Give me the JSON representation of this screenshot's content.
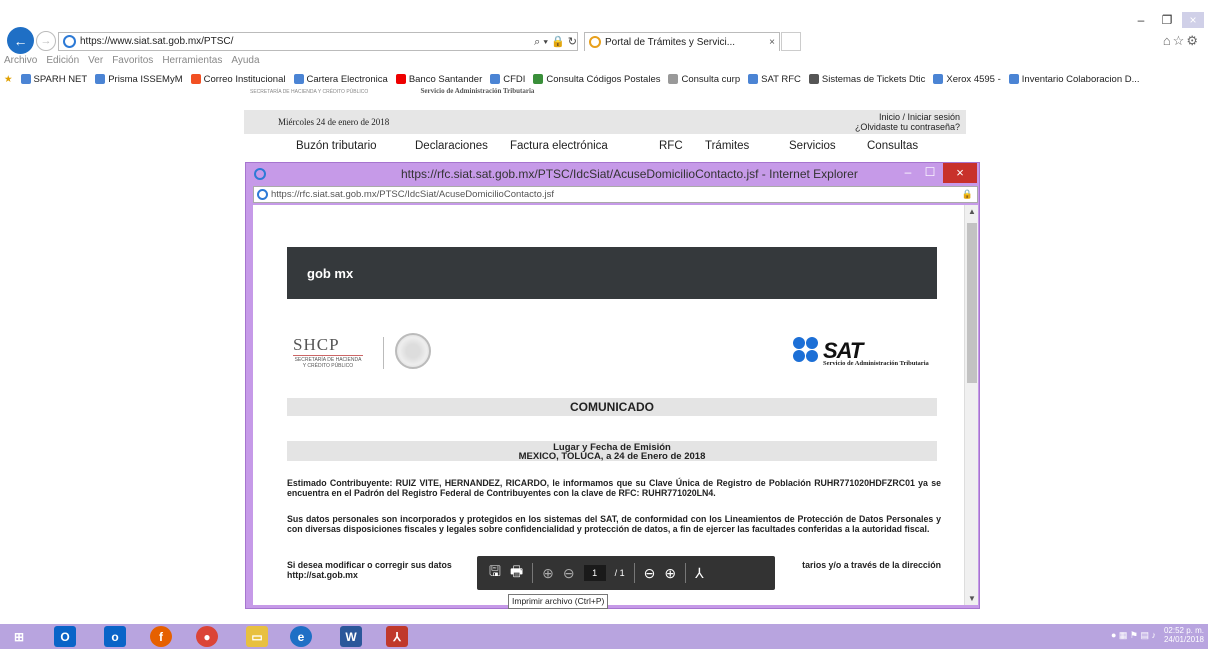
{
  "browser": {
    "url": "https://www.siat.sat.gob.mx/PTSC/",
    "tab_title": "Portal de Trámites y Servici...",
    "menu": [
      "Archivo",
      "Edición",
      "Ver",
      "Favoritos",
      "Herramientas",
      "Ayuda"
    ],
    "favorites": [
      "SPARH NET",
      "Prisma ISSEMyM",
      "Correo Institucional",
      "Cartera Electronica",
      "Banco Santander",
      "CFDI",
      "Consulta Códigos Postales",
      "Consulta curp",
      "SAT RFC",
      "Sistemas de Tickets Dtic",
      "Xerox 4595 -",
      "Inventario Colaboracion D..."
    ]
  },
  "bg_page": {
    "header_small": "SECRETARÍA DE HACIENDA Y CRÉDITO PÚBLICO",
    "header_sat": "Servicio de Administración Tributaria",
    "date": "Miércoles 24 de enero de 2018",
    "login": "Inicio / Iniciar sesión",
    "forgot": "¿Olvidaste tu contraseña?",
    "nav": [
      "Buzón tributario",
      "Declaraciones",
      "Factura electrónica",
      "RFC",
      "Trámites",
      "Servicios",
      "Consultas"
    ]
  },
  "popup": {
    "title": "https://rfc.siat.sat.gob.mx/PTSC/IdcSiat/AcuseDomicilioContacto.jsf - Internet Explorer",
    "address": "https://rfc.siat.sat.gob.mx/PTSC/IdcSiat/AcuseDomicilioContacto.jsf"
  },
  "document": {
    "gobmx": "gob mx",
    "shcp": "SHCP",
    "shcp_sub": "SECRETARÍA DE HACIENDA Y CRÉDITO PÚBLICO",
    "sat": "SAT",
    "sat_sub": "Servicio de Administración Tributaria",
    "heading": "COMUNICADO",
    "place_title": "Lugar y Fecha de Emisión",
    "place_value": "MEXICO, TOLUCA, a 24 de Enero de 2018",
    "para1": "Estimado Contribuyente: RUIZ VITE, HERNANDEZ, RICARDO, le informamos que su Clave Única de Registro de Población RUHR771020HDFZRC01 ya se encuentra en el Padrón del Registro Federal de Contribuyentes con la clave de RFC: RUHR771020LN4.",
    "para2": "Sus datos personales son incorporados y protegidos en los sistemas del SAT, de conformidad con los Lineamientos de Protección de Datos Personales y con diversas disposiciones fiscales y legales sobre confidencialidad y protección de datos, a fin de ejercer las facultades conferidas a la autoridad fiscal.",
    "para3_start": "Si desea modificar o corregir sus datos",
    "para3_end": "tarios y/o a través de la dirección",
    "para3_url": "http://sat.gob.mx"
  },
  "pdf_toolbar": {
    "page": "1",
    "total": "/ 1",
    "tooltip": "Imprimir archivo (Ctrl+P)"
  },
  "taskbar": {
    "time": "02:52 p. m.",
    "date": "24/01/2018"
  }
}
